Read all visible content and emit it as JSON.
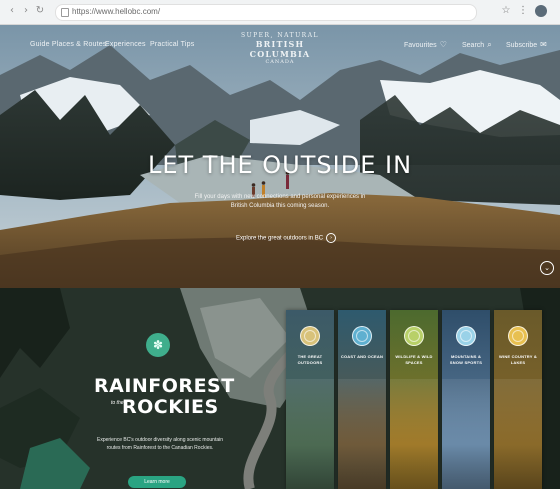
{
  "browser": {
    "url": "https://www.hellobc.com/",
    "nav_icons": [
      "back-icon",
      "forward-icon",
      "reload-icon"
    ],
    "tool_icons": [
      "star-icon",
      "extensions-icon",
      "profile-icon"
    ]
  },
  "site": {
    "logo": {
      "line1": "SUPER, NATURAL",
      "line2": "BRITISH COLUMBIA",
      "line3": "CANADA"
    },
    "nav": [
      {
        "label": "Guide Places & Routes"
      },
      {
        "label": "Experiences"
      },
      {
        "label": "Practical Tips"
      }
    ],
    "utility": {
      "favourites": "Favourites",
      "search": "Search",
      "subscribe": "Subscribe"
    }
  },
  "hero": {
    "title": "LET THE OUTSIDE IN",
    "subtitle": "Fill your days with new connections and personal experiences in British Columbia this coming season.",
    "cta": "Explore the great outdoors in BC"
  },
  "region": {
    "title_line1": "RAINFOREST",
    "title_the": "to the",
    "title_line2": "ROCKIES",
    "description": "Experience BC's outdoor diversity along scenic mountain routes from Rainforest to the Canadian Rockies.",
    "button": "Learn more"
  },
  "cards": [
    {
      "title": "THE GREAT OUTDOORS",
      "medal_color": "#d8c27a",
      "bg_top": "#3c5a68",
      "bg_bottom": "#4c6a52"
    },
    {
      "title": "COAST AND OCEAN",
      "medal_color": "#5fb0d0",
      "bg_top": "#2e5a6e",
      "bg_bottom": "#6f5a3a"
    },
    {
      "title": "WILDLIFE & WILD SPACES",
      "medal_color": "#b8d068",
      "bg_top": "#4c6a2e",
      "bg_bottom": "#a07a2a"
    },
    {
      "title": "MOUNTAINS & SNOW SPORTS",
      "medal_color": "#9ad2e8",
      "bg_top": "#2f4e6a",
      "bg_bottom": "#6a8aa8"
    },
    {
      "title": "WINE COUNTRY & LAKES",
      "medal_color": "#e8c050",
      "bg_top": "#6a5a2a",
      "bg_bottom": "#8a6a2a"
    }
  ],
  "colors": {
    "accent_green": "#2aa482",
    "region_badge": "#3fae8c"
  }
}
